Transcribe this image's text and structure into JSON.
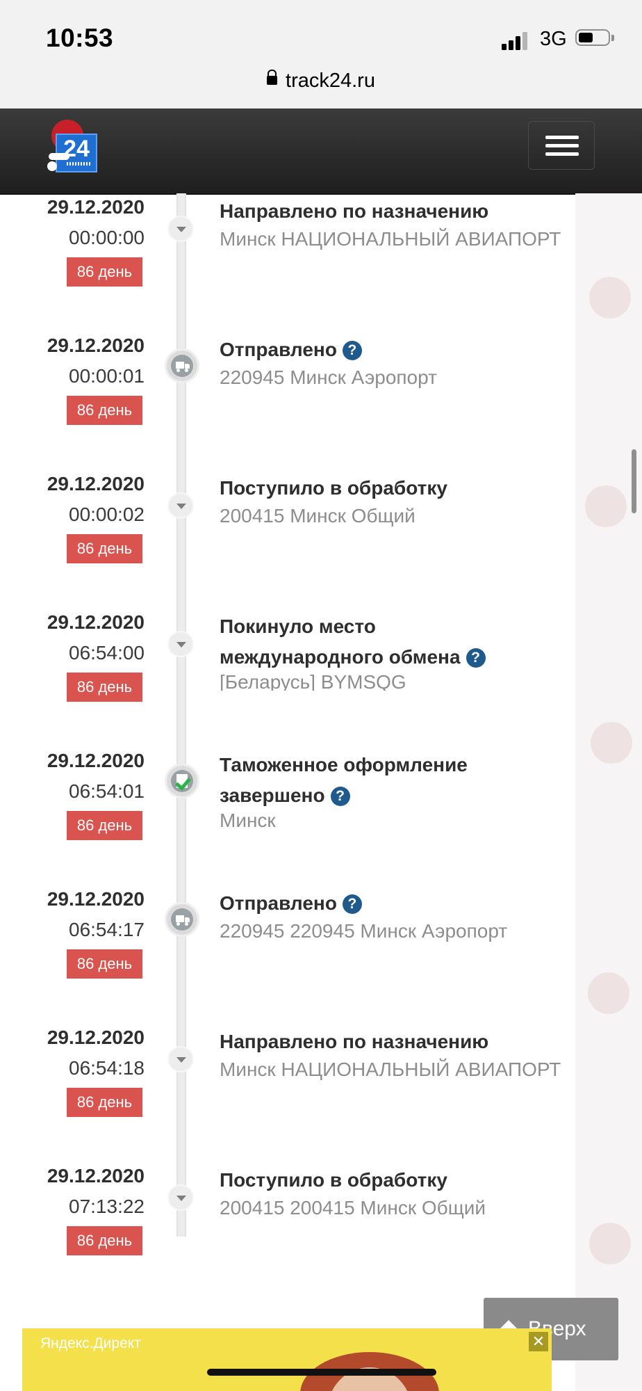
{
  "status_bar": {
    "time": "10:53",
    "network": "3G",
    "icons": [
      "cellular-signal-icon",
      "battery-icon"
    ]
  },
  "browser": {
    "url": "track24.ru",
    "icons": [
      "lock-icon"
    ]
  },
  "header": {
    "logo_text": "24",
    "icons": [
      "hamburger-menu-icon"
    ]
  },
  "colors": {
    "badge": "#d9534f",
    "help": "#1f5a8e",
    "header": "#2a2a2a",
    "check": "#2db24a"
  },
  "events": [
    {
      "date": "29.12.2020",
      "time": "00:00:00",
      "days": "86 день",
      "title": "Направлено по назначению",
      "location": "Минск НАЦИОНАЛЬНЫЙ АВИАПОРТ",
      "icon": "chevron-down-icon"
    },
    {
      "date": "29.12.2020",
      "time": "00:00:01",
      "days": "86 день",
      "title": "Отправлено",
      "location": "220945 Минск Аэропорт",
      "icon": "truck-icon"
    },
    {
      "date": "29.12.2020",
      "time": "00:00:02",
      "days": "86 день",
      "title": "Поступило в обработку",
      "location": "200415 Минск Общий",
      "icon": "chevron-down-icon"
    },
    {
      "date": "29.12.2020",
      "time": "06:54:00",
      "days": "86 день",
      "title": "Покинуло место",
      "title_line2": "международного обмена",
      "location": "[Беларусь] BYMSQG",
      "icon": "chevron-down-icon"
    },
    {
      "date": "29.12.2020",
      "time": "06:54:01",
      "days": "86 день",
      "title": "Таможенное оформление",
      "title_line2": "завершено",
      "location": "Минск",
      "icon": "customs-check-icon"
    },
    {
      "date": "29.12.2020",
      "time": "06:54:17",
      "days": "86 день",
      "title": "Отправлено",
      "location": "220945 220945 Минск Аэропорт",
      "icon": "truck-icon"
    },
    {
      "date": "29.12.2020",
      "time": "06:54:18",
      "days": "86 день",
      "title": "Направлено по назначению",
      "location": "Минск НАЦИОНАЛЬНЫЙ АВИАПОРТ",
      "icon": "chevron-down-icon"
    },
    {
      "date": "29.12.2020",
      "time": "07:13:22",
      "days": "86 день",
      "title": "Поступило в обработку",
      "location": "200415 200415 Минск Общий",
      "icon": "chevron-down-icon"
    }
  ],
  "help_glyph": "?",
  "up_button": {
    "label": "Вверх"
  },
  "ad": {
    "label": "Яндекс.Директ",
    "close": "✕"
  }
}
